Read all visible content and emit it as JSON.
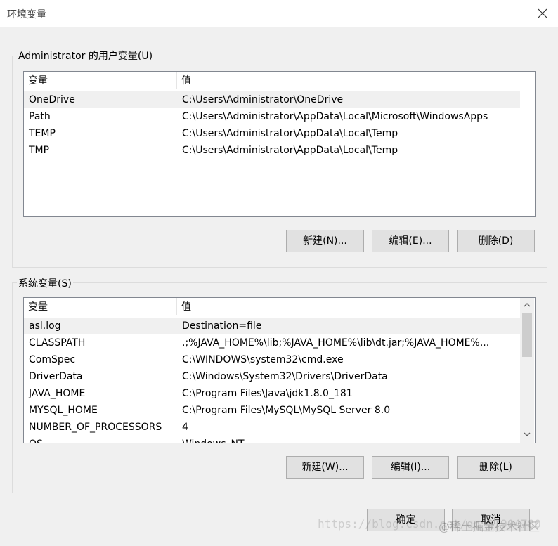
{
  "window": {
    "title": "环境变量"
  },
  "user_group": {
    "label": "Administrator 的用户变量(U)",
    "columns": [
      "变量",
      "值"
    ],
    "rows": [
      {
        "name": "OneDrive",
        "value": "C:\\Users\\Administrator\\OneDrive"
      },
      {
        "name": "Path",
        "value": "C:\\Users\\Administrator\\AppData\\Local\\Microsoft\\WindowsApps"
      },
      {
        "name": "TEMP",
        "value": "C:\\Users\\Administrator\\AppData\\Local\\Temp"
      },
      {
        "name": "TMP",
        "value": "C:\\Users\\Administrator\\AppData\\Local\\Temp"
      }
    ],
    "buttons": {
      "new": "新建(N)...",
      "edit": "编辑(E)...",
      "delete": "删除(D)"
    }
  },
  "system_group": {
    "label": "系统变量(S)",
    "columns": [
      "变量",
      "值"
    ],
    "rows": [
      {
        "name": "asl.log",
        "value": "Destination=file"
      },
      {
        "name": "CLASSPATH",
        "value": ".;%JAVA_HOME%\\lib;%JAVA_HOME%\\lib\\dt.jar;%JAVA_HOME%..."
      },
      {
        "name": "ComSpec",
        "value": "C:\\WINDOWS\\system32\\cmd.exe"
      },
      {
        "name": "DriverData",
        "value": "C:\\Windows\\System32\\Drivers\\DriverData"
      },
      {
        "name": "JAVA_HOME",
        "value": "C:\\Program Files\\Java\\jdk1.8.0_181"
      },
      {
        "name": "MYSQL_HOME",
        "value": "C:\\Program Files\\MySQL\\MySQL Server 8.0"
      },
      {
        "name": "NUMBER_OF_PROCESSORS",
        "value": "4"
      },
      {
        "name": "OS",
        "value": "Windows_NT"
      }
    ],
    "buttons": {
      "new": "新建(W)...",
      "edit": "编辑(I)...",
      "delete": "删除(L)"
    }
  },
  "footer": {
    "ok": "确定",
    "cancel": "取消"
  },
  "watermark": {
    "url": "https://blog.csdn.net/qq_37904780",
    "site": "@稀土掘金技术社区"
  }
}
